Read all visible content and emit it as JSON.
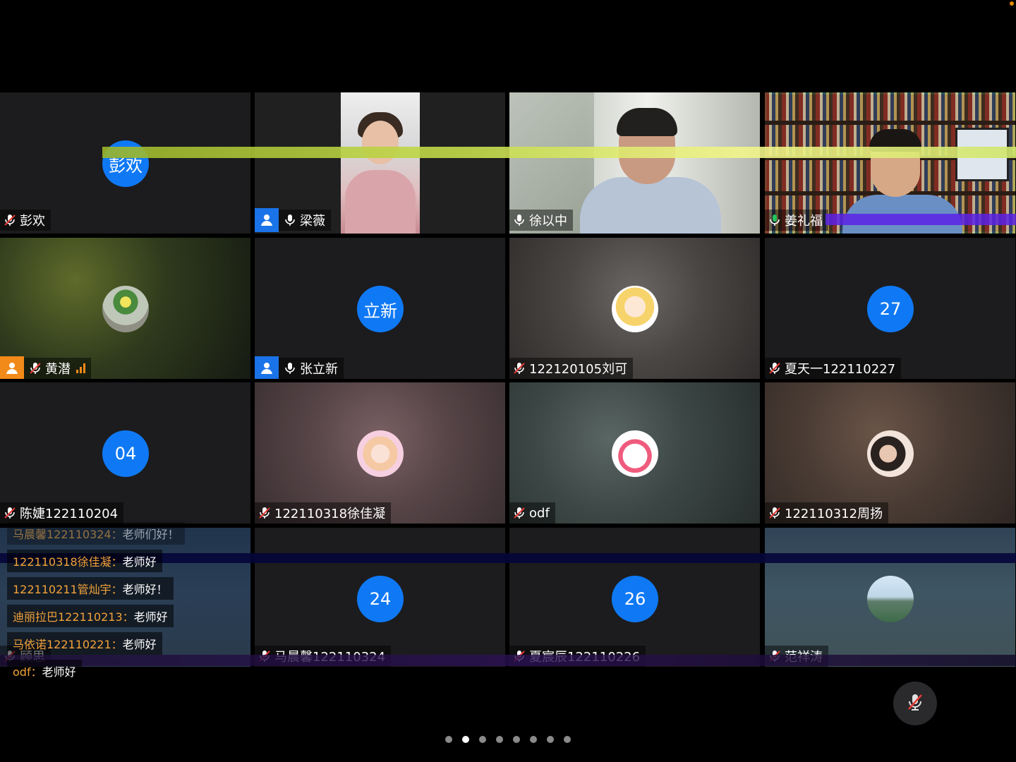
{
  "tiles": [
    {
      "name": "彭欢",
      "avatar_text": "彭欢",
      "mic": "muted"
    },
    {
      "name": "梁薇",
      "mic": "on",
      "host": true
    },
    {
      "name": "徐以中",
      "mic": "on"
    },
    {
      "name": "姜礼福",
      "mic": "on",
      "active_speaker": true
    },
    {
      "name": "黄潜",
      "mic": "muted",
      "host": true,
      "signal": "good"
    },
    {
      "name": "张立新",
      "avatar_text": "立新",
      "mic": "on",
      "host": true
    },
    {
      "name": "122120105刘可",
      "mic": "muted"
    },
    {
      "name": "夏天一122110227",
      "avatar_text": "27",
      "mic": "muted"
    },
    {
      "name": "陈婕122110204",
      "avatar_text": "04",
      "mic": "muted"
    },
    {
      "name": "122110318徐佳凝",
      "mic": "muted"
    },
    {
      "name": "odf",
      "mic": "muted"
    },
    {
      "name": "122110312周扬",
      "mic": "muted"
    },
    {
      "name": "顾思",
      "mic": "muted"
    },
    {
      "name": "马晨馨122110324",
      "avatar_text": "24",
      "mic": "muted"
    },
    {
      "name": "夏宸辰122110226",
      "avatar_text": "26",
      "mic": "muted"
    },
    {
      "name": "范祥涛",
      "mic": "muted"
    }
  ],
  "chat": [
    {
      "sender": "马晨馨122110324：",
      "message": "老师们好！"
    },
    {
      "sender": "122110318徐佳凝：",
      "message": "老师好"
    },
    {
      "sender": "122110211管灿宇：",
      "message": "老师好！"
    },
    {
      "sender": "迪丽拉巴122110213：",
      "message": "老师好"
    },
    {
      "sender": "马依诺122110221：",
      "message": "老师好"
    },
    {
      "sender": "odf：",
      "message": "老师好"
    }
  ],
  "colors": {
    "accent": "#0f79f5",
    "active_border": "#22c55e",
    "host_badge": "#1a73e8",
    "orange": "#f28a19"
  },
  "pager": {
    "pages": 8,
    "current": 2
  }
}
